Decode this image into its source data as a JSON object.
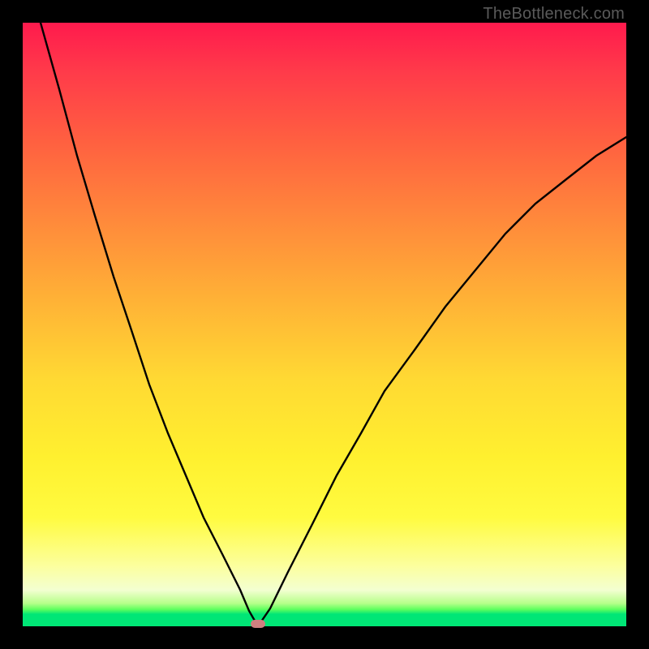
{
  "watermark": "TheBottleneck.com",
  "colors": {
    "frame": "#000000",
    "curve": "#000000",
    "marker": "#d08080"
  },
  "chart_data": {
    "type": "line",
    "title": "",
    "xlabel": "",
    "ylabel": "",
    "xlim": [
      0,
      100
    ],
    "ylim": [
      0,
      100
    ],
    "grid": false,
    "legend": false,
    "annotations": [
      {
        "text": "TheBottleneck.com",
        "position": "top-right"
      }
    ],
    "marker": {
      "x": 39,
      "y": 0
    },
    "series": [
      {
        "name": "left-branch",
        "x": [
          3,
          6,
          9,
          12,
          15,
          18,
          21,
          24,
          27,
          30,
          33,
          36,
          37.5,
          39
        ],
        "y": [
          100,
          89,
          78,
          68,
          58,
          49,
          40,
          32,
          25,
          18,
          12,
          6,
          2.5,
          0
        ]
      },
      {
        "name": "right-branch",
        "x": [
          39,
          41,
          44,
          48,
          52,
          56,
          60,
          65,
          70,
          75,
          80,
          85,
          90,
          95,
          100
        ],
        "y": [
          0,
          3,
          9,
          17,
          25,
          32,
          39,
          46,
          53,
          59,
          65,
          70,
          74,
          78,
          81
        ]
      }
    ]
  }
}
